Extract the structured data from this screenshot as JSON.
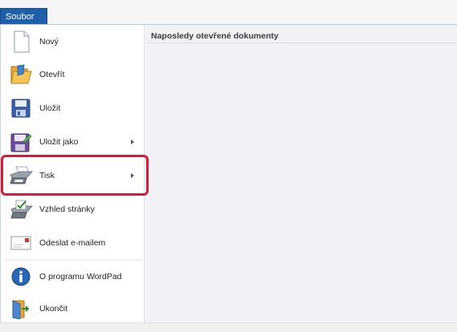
{
  "tabs": {
    "file_label": "Soubor"
  },
  "recent": {
    "title": "Naposledy otevřené dokumenty"
  },
  "menu": {
    "items": [
      {
        "label": "Nový",
        "icon": "new-document-icon",
        "has_arrow": false
      },
      {
        "label": "Otevřít",
        "icon": "open-folder-icon",
        "has_arrow": false
      },
      {
        "label": "Uložit",
        "icon": "save-disk-icon",
        "has_arrow": false
      },
      {
        "label": "Uložit jako",
        "icon": "save-as-icon",
        "has_arrow": true
      },
      {
        "label": "Tisk",
        "icon": "printer-icon",
        "has_arrow": true
      },
      {
        "label": "Vzhled stránky",
        "icon": "page-setup-icon",
        "has_arrow": false
      },
      {
        "label": "Odeslat e-mailem",
        "icon": "email-icon",
        "has_arrow": false
      },
      {
        "label": "O programu WordPad",
        "icon": "info-icon",
        "has_arrow": false
      },
      {
        "label": "Ukončit",
        "icon": "exit-icon",
        "has_arrow": false
      }
    ]
  },
  "colors": {
    "accent": "#1f5ea8",
    "highlight": "#d21d37"
  }
}
